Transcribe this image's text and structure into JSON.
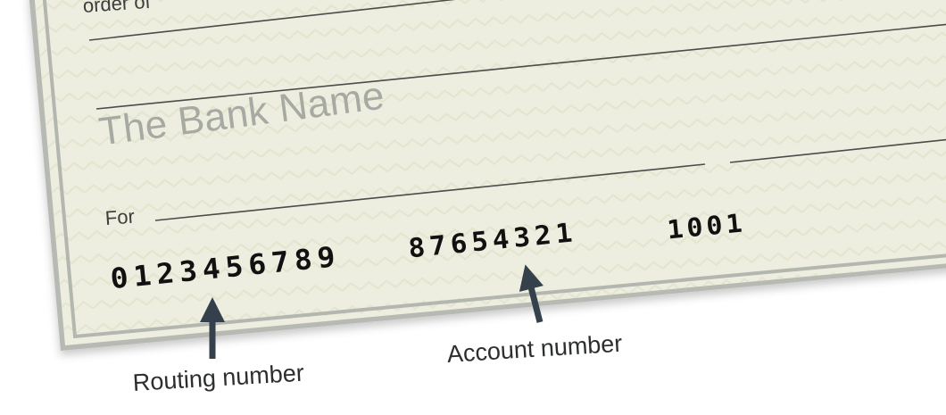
{
  "check": {
    "payee_line_label": "order of",
    "bank_name": "The Bank Name",
    "memo_label": "For",
    "routing_number_micr": "0123456789",
    "account_number_micr": "87654321",
    "check_number_micr": "1001"
  },
  "callouts": {
    "routing_label": "Routing number",
    "account_label": "Account number"
  },
  "colors": {
    "paper": "#eeeee0",
    "frame": "#b4b7b0",
    "chevron_pattern": "#e3e5cf",
    "bank_name_text": "#a7aaa3",
    "arrow": "#34404b"
  }
}
